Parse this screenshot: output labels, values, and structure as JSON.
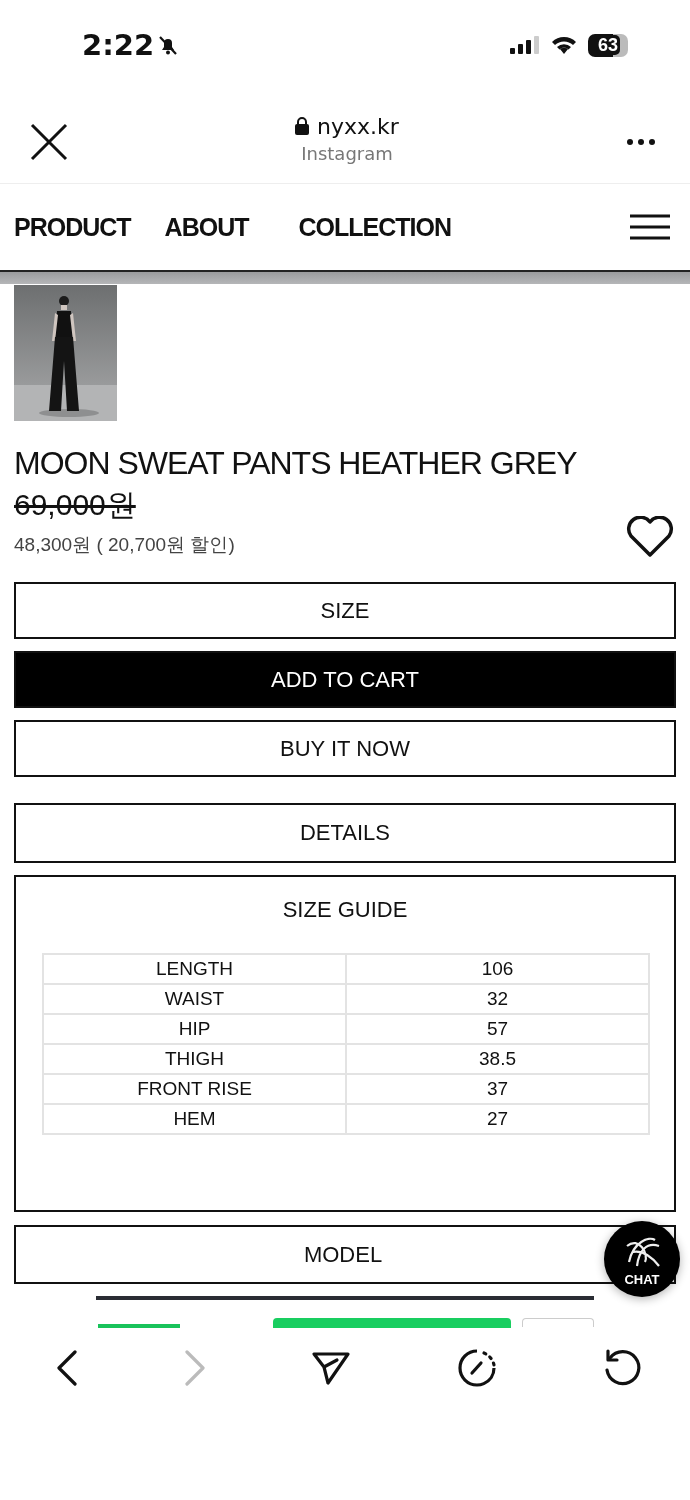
{
  "status_bar": {
    "time": "2:22",
    "silent": true,
    "battery": "63"
  },
  "browser": {
    "domain": "nyxx.kr",
    "source": "Instagram"
  },
  "nav": {
    "items": [
      {
        "label": "PRODUCT"
      },
      {
        "label": "ABOUT"
      },
      {
        "label": "COLLECTION"
      }
    ]
  },
  "product": {
    "title": "MOON SWEAT PANTS HEATHER GREY",
    "original_price": "69,000원",
    "sale_price": "48,300원 ( 20,700원 할인)",
    "favorited": false
  },
  "actions": [
    {
      "label": "SIZE",
      "kind": "outline"
    },
    {
      "label": "ADD TO CART",
      "kind": "filled"
    },
    {
      "label": "BUY IT NOW",
      "kind": "outline"
    }
  ],
  "details": {
    "label": "DETAILS"
  },
  "size_guide": {
    "title": "SIZE GUIDE",
    "rows": [
      {
        "name": "LENGTH",
        "value": "106"
      },
      {
        "name": "WAIST",
        "value": "32"
      },
      {
        "name": "HIP",
        "value": "57"
      },
      {
        "name": "THIGH",
        "value": "38.5"
      },
      {
        "name": "FRONT RISE",
        "value": "37"
      },
      {
        "name": "HEM",
        "value": "27"
      }
    ]
  },
  "model": {
    "label": "MODEL"
  },
  "chat": {
    "label": "CHAT"
  },
  "toolbar": {
    "items": [
      {
        "kind": "back",
        "disabled": false
      },
      {
        "kind": "forward",
        "disabled": true
      },
      {
        "kind": "share",
        "disabled": false
      },
      {
        "kind": "timer",
        "disabled": false
      },
      {
        "kind": "reload",
        "disabled": false
      }
    ]
  }
}
